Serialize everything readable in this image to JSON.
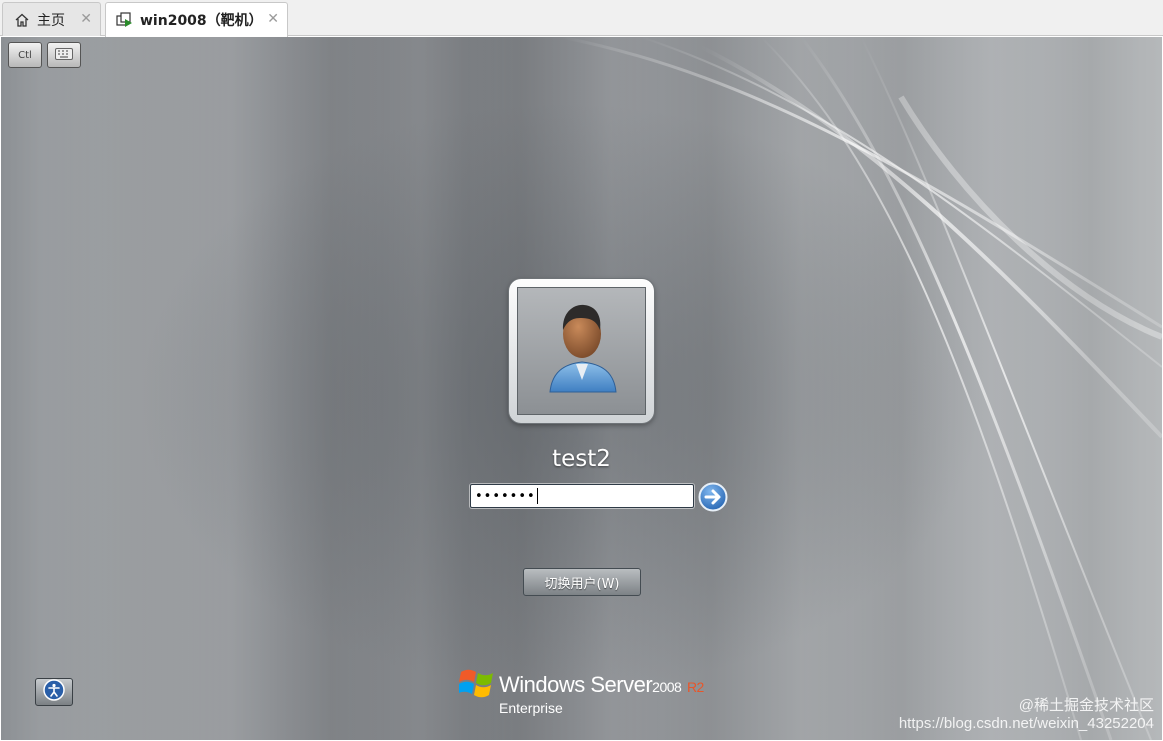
{
  "tabs": [
    {
      "label": "主页",
      "icon": "home-icon",
      "close": "✕",
      "active": false
    },
    {
      "label": "win2008（靶机）",
      "icon": "vm-icon",
      "close": "✕",
      "active": true
    }
  ],
  "toolbar": {
    "cad_label": "Ctl",
    "keyboard_icon": "keyboard-icon"
  },
  "login": {
    "username": "test2",
    "password_masked": "•••••••",
    "submit_icon": "arrow-right-icon",
    "switch_user_label": "切换用户(W)",
    "ease_of_access_icon": "ease-of-access-icon"
  },
  "branding": {
    "product": "Windows Server",
    "version": "2008",
    "release": "R2",
    "edition": "Enterprise",
    "logo_icon": "windows-flag-icon"
  },
  "watermark": {
    "line1": "@稀土掘金技术社区",
    "line2": "https://blog.csdn.net/weixin_43252204"
  },
  "colors": {
    "accent_blue": "#1f6fc6",
    "r2_orange": "#e8562a"
  }
}
